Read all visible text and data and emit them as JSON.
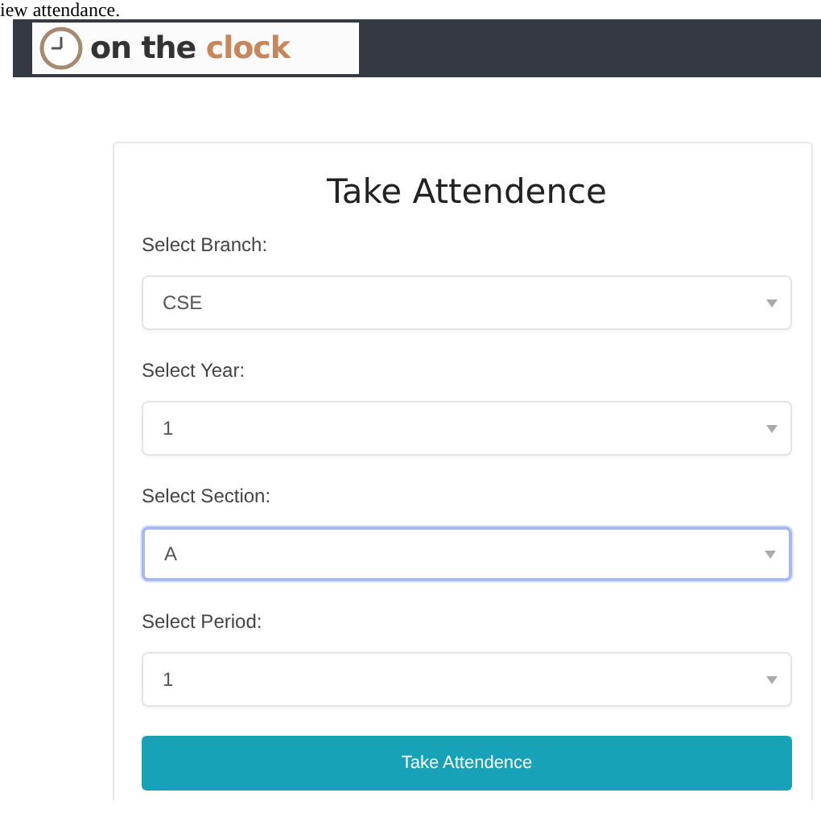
{
  "document_text": "iew attendance.",
  "navbar": {
    "logo": {
      "word_1": "on the",
      "word_2": "clock"
    }
  },
  "form": {
    "title": "Take Attendence",
    "fields": [
      {
        "label": "Select Branch:",
        "value": "CSE",
        "focused": false
      },
      {
        "label": "Select Year:",
        "value": "1",
        "focused": false
      },
      {
        "label": "Select Section:",
        "value": "A",
        "focused": true
      },
      {
        "label": "Select Period:",
        "value": "1",
        "focused": false
      }
    ],
    "submit_button": "Take Attendence"
  }
}
